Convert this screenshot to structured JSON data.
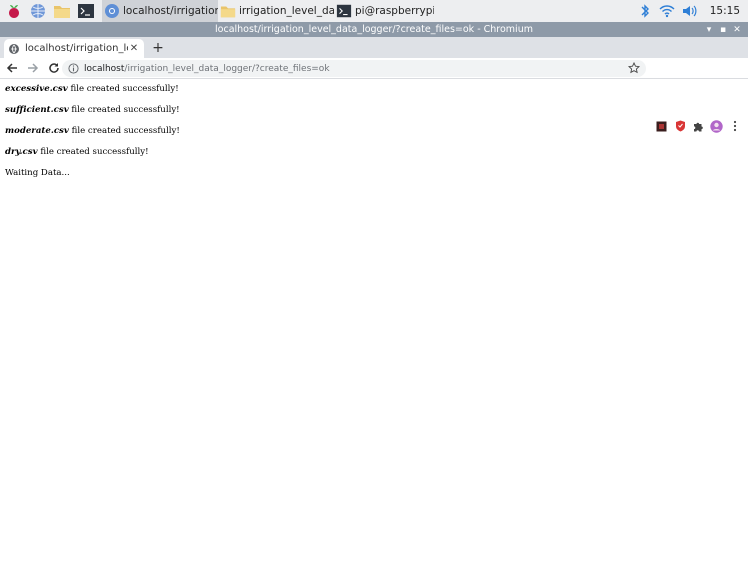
{
  "taskbar": {
    "tasks": [
      {
        "label": "localhost/irrigation_le..."
      },
      {
        "label": "irrigation_level_data_l..."
      },
      {
        "label": "pi@raspberrypi: ~"
      }
    ],
    "clock": "15:15"
  },
  "window": {
    "title": "localhost/irrigation_level_data_logger/?create_files=ok - Chromium"
  },
  "browser": {
    "tab_label": "localhost/irrigation_level",
    "new_tab": "+",
    "url_host": "localhost",
    "url_rest": "/irrigation_level_data_logger/?create_files=ok"
  },
  "page": {
    "lines": [
      {
        "file": "excessive.csv",
        "text": " file created successfully!"
      },
      {
        "file": "sufficient.csv",
        "text": " file created successfully!"
      },
      {
        "file": "moderate.csv",
        "text": " file created successfully!"
      },
      {
        "file": "dry.csv",
        "text": " file created successfully!"
      }
    ],
    "status": "Waiting Data..."
  },
  "colors": {
    "taskbar_bg": "#edeef0",
    "titlebar_bg": "#8e9aa8",
    "tabstrip_bg": "#dee1e6",
    "accent": "#3c7dd9"
  }
}
